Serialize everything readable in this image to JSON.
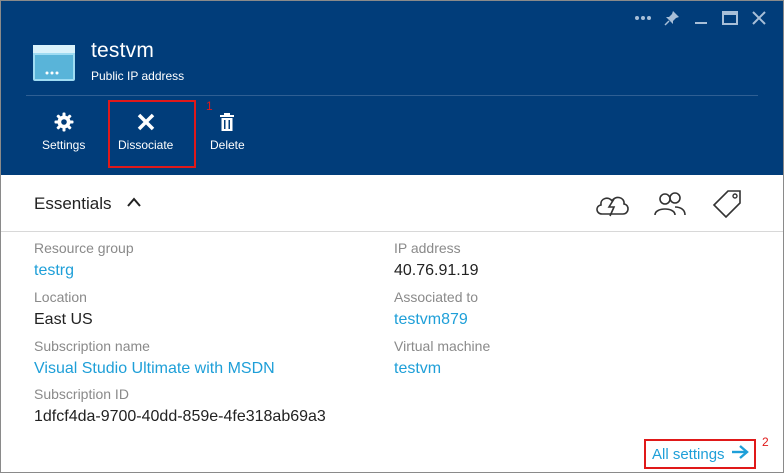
{
  "window_controls": [
    "ellipsis-icon",
    "pin-icon",
    "minimize-icon",
    "maximize-icon",
    "close-icon"
  ],
  "header": {
    "title": "testvm",
    "subtitle": "Public IP address",
    "commands": [
      {
        "label": "Settings",
        "icon": "gear-icon"
      },
      {
        "label": "Dissociate",
        "icon": "close-x-icon"
      },
      {
        "label": "Delete",
        "icon": "trash-icon"
      }
    ]
  },
  "annotations": {
    "marker_1": "1",
    "marker_2": "2",
    "color": "#e01919"
  },
  "essentials": {
    "title": "Essentials",
    "icons": [
      "cloud-lightning-icon",
      "users-icon",
      "tag-icon"
    ]
  },
  "properties": {
    "resource_group": {
      "label": "Resource group",
      "value": "testrg"
    },
    "location": {
      "label": "Location",
      "value": "East US"
    },
    "subscription_name": {
      "label": "Subscription name",
      "value": "Visual Studio Ultimate with MSDN"
    },
    "subscription_id": {
      "label": "Subscription ID",
      "value": "1dfcf4da-9700-40dd-859e-4fe318ab69a3"
    },
    "ip_address": {
      "label": "IP address",
      "value": "40.76.91.19"
    },
    "associated_to": {
      "label": "Associated to",
      "value": "testvm879"
    },
    "virtual_machine": {
      "label": "Virtual machine",
      "value": "testvm"
    }
  },
  "footer": {
    "all_settings": "All settings"
  },
  "colors": {
    "header_bg": "#013d7a",
    "link": "#1e9fd8",
    "label": "#8a8a8a"
  }
}
